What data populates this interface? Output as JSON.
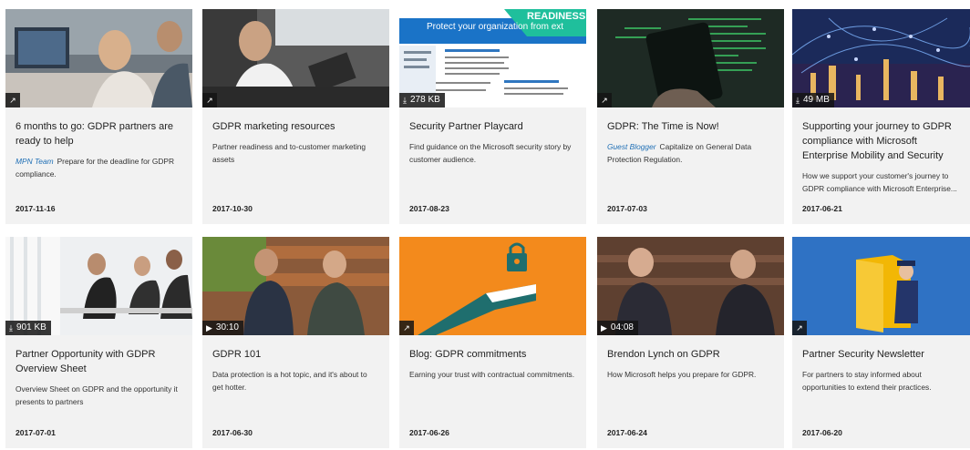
{
  "cards": [
    {
      "title": "6 months to go: GDPR partners are ready to help",
      "author": "MPN Team",
      "desc": "Prepare for the deadline for GDPR compliance.",
      "date": "2017-11-16",
      "badge_icon": "external-link-icon",
      "badge_text": ""
    },
    {
      "title": "GDPR marketing resources",
      "author": "",
      "desc": "Partner readiness and to-customer marketing assets",
      "date": "2017-10-30",
      "badge_icon": "external-link-icon",
      "badge_text": ""
    },
    {
      "title": "Security Partner Playcard",
      "author": "",
      "desc": "Find guidance on the Microsoft security story by customer audience.",
      "date": "2017-08-23",
      "badge_icon": "download-icon",
      "badge_text": "278 KB"
    },
    {
      "title": "GDPR: The Time is Now!",
      "author": "Guest Blogger",
      "desc": "Capitalize on General Data Protection Regulation.",
      "date": "2017-07-03",
      "badge_icon": "external-link-icon",
      "badge_text": ""
    },
    {
      "title": "Supporting your journey to GDPR compliance with Microsoft Enterprise Mobility and Security",
      "author": "",
      "desc": "How we support your customer's journey to GDPR compliance with Microsoft Enterprise...",
      "date": "2017-06-21",
      "badge_icon": "download-icon",
      "badge_text": "49 MB"
    },
    {
      "title": "Partner Opportunity with GDPR Overview Sheet",
      "author": "",
      "desc": "Overview Sheet on GDPR and the opportunity it presents to partners",
      "date": "2017-07-01",
      "badge_icon": "download-icon",
      "badge_text": "901 KB"
    },
    {
      "title": "GDPR 101",
      "author": "",
      "desc": "Data protection is a hot topic, and it's about to get hotter.",
      "date": "2017-06-30",
      "badge_icon": "play-icon",
      "badge_text": "30:10"
    },
    {
      "title": "Blog: GDPR commitments",
      "author": "",
      "desc": "Earning your trust with contractual commitments.",
      "date": "2017-06-26",
      "badge_icon": "external-link-icon",
      "badge_text": ""
    },
    {
      "title": "Brendon Lynch on GDPR",
      "author": "",
      "desc": "How Microsoft helps you prepare for GDPR.",
      "date": "2017-06-24",
      "badge_icon": "play-icon",
      "badge_text": "04:08"
    },
    {
      "title": "Partner Security Newsletter",
      "author": "",
      "desc": "For partners to stay informed about opportunities to extend their practices.",
      "date": "2017-06-20",
      "badge_icon": "external-link-icon",
      "badge_text": ""
    }
  ],
  "thumbs": {
    "playcard_heading": "Protect your organization from external threats (Security)",
    "playcard_banner": "READINESS"
  }
}
